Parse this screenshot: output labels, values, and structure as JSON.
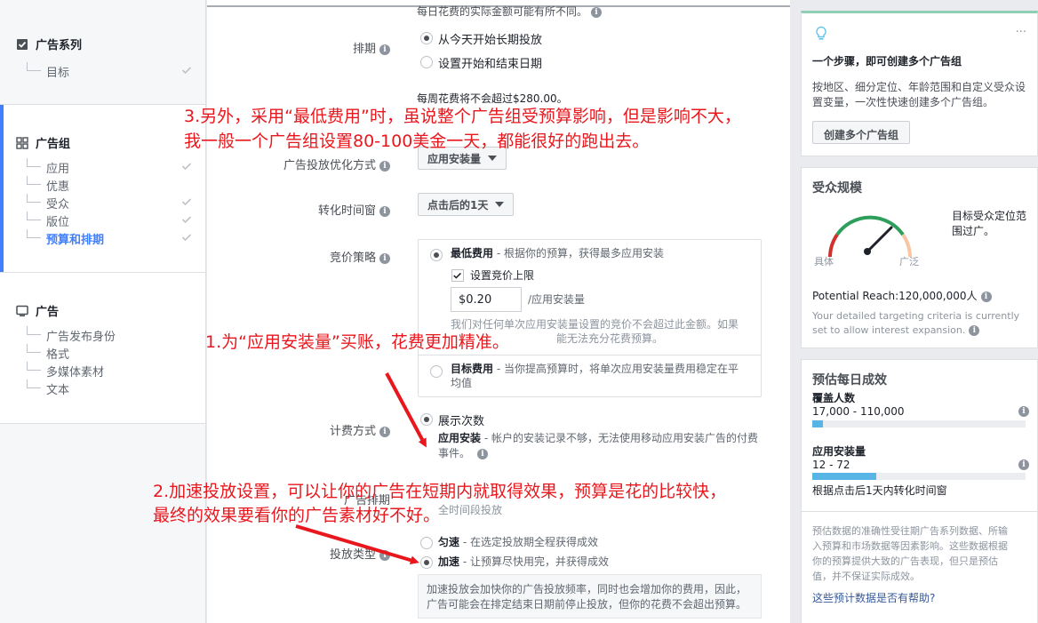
{
  "nav": {
    "campaign": {
      "title": "广告系列",
      "items": [
        {
          "label": "目标",
          "done": true
        }
      ]
    },
    "adset": {
      "title": "广告组",
      "items": [
        {
          "label": "应用",
          "done": true
        },
        {
          "label": "优惠",
          "done": false
        },
        {
          "label": "受众",
          "done": true
        },
        {
          "label": "版位",
          "done": true
        },
        {
          "label": "预算和排期",
          "done": true,
          "current": true
        }
      ]
    },
    "ad": {
      "title": "广告",
      "items": [
        {
          "label": "广告发布身份"
        },
        {
          "label": "格式"
        },
        {
          "label": "多媒体素材"
        },
        {
          "label": "文本"
        }
      ]
    }
  },
  "form": {
    "top_note": "每日花费的实际金额可能有所不同。",
    "schedule": {
      "label": "排期",
      "opt1": "从今天开始长期投放",
      "opt2": "设置开始和结束日期"
    },
    "weekly_note": "每周花费将不会超过$280.00。",
    "optimization": {
      "label": "广告投放优化方式",
      "value": "应用安装量"
    },
    "window": {
      "label": "转化时间窗",
      "value": "点击后的1天"
    },
    "bid": {
      "label": "竞价策略",
      "lowest_title": "最低费用",
      "lowest_desc": " - 根据你的预算，获得最多应用安装",
      "cap_label": "设置竞价上限",
      "cap_value": "$0.20",
      "cap_unit": "/应用安装量",
      "cap_note_1": "我们对任何单次应用安装量设置的竞价不会超过此金额。如果",
      "cap_note_2": "能无法充分花费预算。",
      "target_title": "目标费用",
      "target_desc_1": " - 当你提高预算时，将单次应用安装量费用稳定在平",
      "target_desc_2": "均值"
    },
    "billing": {
      "label": "计费方式",
      "opt": "展示次数",
      "desc_bold": "应用安装",
      "desc_1": " - 帐户的安装记录不够，无法使用移动应用安装广告的付费",
      "desc_2": "事件。"
    },
    "schedule_hidden": {
      "label": "广告排期",
      "opt": "全时间段投放"
    },
    "delivery": {
      "label": "投放类型",
      "std_title": "匀速",
      "std_desc": " - 在选定投放期全程获得成效",
      "acc_title": "加速",
      "acc_desc": " - 让预算尽快用完，并获得成效",
      "note_1": "加速投放会加快你的广告投放频率，同时也会增加你的费用，因此，",
      "note_2": "广告可能会在排定结束日期前停止投放，但你的花费不会超出预算。"
    }
  },
  "right": {
    "tip": {
      "title": "一个步骤，即可创建多个广告组",
      "desc_1": "按地区、细分定位、年龄范围和自定义受众设",
      "desc_2": "置变量，一次性快速创建多个广告组。",
      "button": "创建多个广告组",
      "more": "···"
    },
    "audience": {
      "title": "受众规模",
      "gauge_left": "具体",
      "gauge_right": "广泛",
      "summary_1": "目标受众定位范",
      "summary_2": "围过广。",
      "reach": "Potential Reach:120,000,000人",
      "note_1": "Your detailed targeting criteria is currently",
      "note_2": "set to allow interest expansion."
    },
    "estimate": {
      "title": "预估每日成效",
      "reach_label": "覆盖人数",
      "reach_value": "17,000 - 110,000",
      "reach_fill": 0.05,
      "installs_label": "应用安装量",
      "installs_value": "12 - 72",
      "installs_fill": 0.3,
      "window_note": "根据点击后1天内转化时间窗",
      "disclaimer_1": "预估数据的准确性受往期广告系列数据、所输",
      "disclaimer_2": "入预算和市场数据等因素影响。这些数据根据",
      "disclaimer_3": "你的预算提供大致的广告表现，但只是预估",
      "disclaimer_4": "值，并不保证实际成效。",
      "link": "这些预计数据是否有帮助?"
    }
  },
  "annotations": {
    "a3_line1": "3.另外，采用“最低费用”时，虽说整个广告组受预算影响，但是影响不大，",
    "a3_line2": "我一般一个广告组设置80-100美金一天，都能很好的跑出去。",
    "a1": "1.为“应用安装量”买账，花费更加精准。",
    "a2_line1": "2.加速投放设置，可以让你的广告在短期内就取得效果，预算是花的比较快，",
    "a2_line2": "最终的效果要看你的广告素材好不好。"
  },
  "colors": {
    "accent": "#4080ff",
    "annotation": "#e8171d",
    "gauge_green": "#2e9e5b",
    "gauge_red": "#d0312d",
    "bar": "#57b5e6"
  }
}
